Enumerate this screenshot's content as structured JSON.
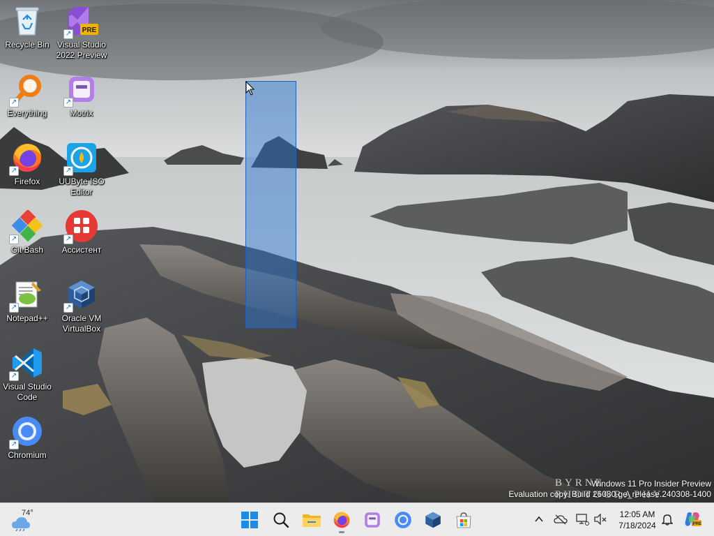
{
  "desktop": {
    "icons": [
      {
        "label": "Recycle Bin",
        "icon": "recycle-bin-icon"
      },
      {
        "label": "Visual Studio 2022 Preview",
        "icon": "visual-studio-preview-icon",
        "badge": "PRE"
      },
      {
        "label": "Everything",
        "icon": "everything-search-icon"
      },
      {
        "label": "Motrix",
        "icon": "motrix-icon"
      },
      {
        "label": "Firefox",
        "icon": "firefox-icon"
      },
      {
        "label": "UUByte ISO Editor",
        "icon": "uubyte-iso-editor-icon"
      },
      {
        "label": "Git Bash",
        "icon": "git-bash-icon"
      },
      {
        "label": "Ассистент",
        "icon": "assistant-icon"
      },
      {
        "label": "Notepad++",
        "icon": "notepad-plus-plus-icon"
      },
      {
        "label": "Oracle VM VirtualBox",
        "icon": "virtualbox-icon"
      },
      {
        "label": "Visual Studio Code",
        "icon": "vscode-icon"
      },
      {
        "label": "Chromium",
        "icon": "chromium-icon"
      }
    ],
    "photo_credit": "BYRNE PHOTOGRAPHY",
    "watermark": {
      "line1": "Windows 11 Pro Insider Preview",
      "line2": "Evaluation copy. Build 26080.ge_release.240308-1400"
    }
  },
  "taskbar": {
    "weather": {
      "temp": "74°",
      "icon": "weather-cloud-icon"
    },
    "apps": [
      {
        "name": "start",
        "icon": "windows-start-icon"
      },
      {
        "name": "search",
        "icon": "search-icon"
      },
      {
        "name": "file-explorer",
        "icon": "file-explorer-icon"
      },
      {
        "name": "firefox",
        "icon": "firefox-icon",
        "running": true
      },
      {
        "name": "motrix",
        "icon": "motrix-icon"
      },
      {
        "name": "chromium",
        "icon": "chromium-icon"
      },
      {
        "name": "virtualbox",
        "icon": "virtualbox-icon"
      },
      {
        "name": "microsoft-store",
        "icon": "store-icon"
      }
    ],
    "tray": [
      "chevron-up-icon",
      "onedrive-offline-icon",
      "network-icon",
      "volume-muted-icon"
    ],
    "clock": {
      "time": "12:05 AM",
      "date": "7/18/2024"
    },
    "notification_icon": "bell-icon",
    "copilot_icon": "copilot-icon"
  }
}
